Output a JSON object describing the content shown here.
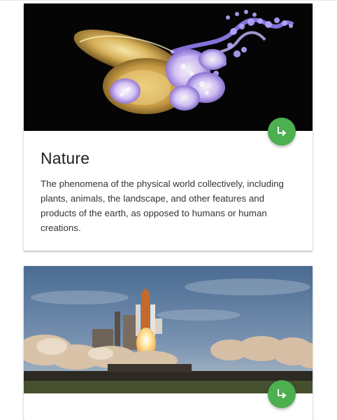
{
  "cards": [
    {
      "image": "jellyfish-photo",
      "title": "Nature",
      "description": "The phenomena of the physical world collectively, including plants, animals, the landscape, and other features and products of the earth, as opposed to humans or human creations.",
      "action_icon": "arrow-right-turn-icon"
    },
    {
      "image": "space-shuttle-launch-photo",
      "action_icon": "arrow-right-turn-icon"
    }
  ],
  "colors": {
    "accent": "#4caf50",
    "title": "#212121",
    "text": "#333333"
  }
}
